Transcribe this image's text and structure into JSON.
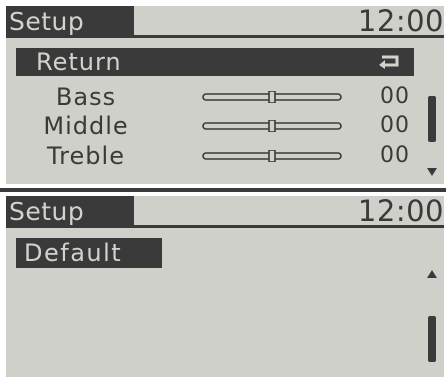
{
  "screen1": {
    "title": "Setup",
    "clock": "12:00",
    "selected_item": "Return",
    "selected_icon": "return-arrow-icon",
    "rows": [
      {
        "label": "Bass",
        "value": "00",
        "level": 0.5
      },
      {
        "label": "Middle",
        "value": "00",
        "level": 0.5
      },
      {
        "label": "Treble",
        "value": "00",
        "level": 0.5
      }
    ]
  },
  "screen2": {
    "title": "Setup",
    "clock": "12:00",
    "default_label": "Default"
  },
  "colors": {
    "screen_background": "#cfd0c9",
    "dark": "#3a3a3a",
    "highlight_text": "#d2d3cc"
  }
}
